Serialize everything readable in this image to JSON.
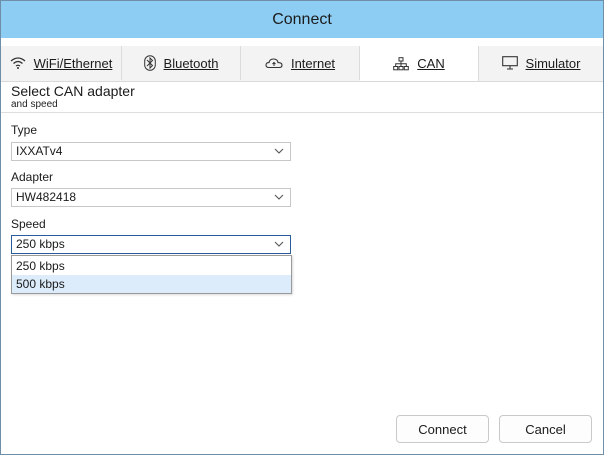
{
  "window": {
    "title": "Connect"
  },
  "tabs": [
    {
      "label": "WiFi/Ethernet",
      "icon": "wifi-icon",
      "active": false
    },
    {
      "label": "Bluetooth",
      "icon": "bluetooth-icon",
      "active": false
    },
    {
      "label": "Internet",
      "icon": "cloud-icon",
      "active": false
    },
    {
      "label": "CAN",
      "icon": "network-icon",
      "active": true
    },
    {
      "label": "Simulator",
      "icon": "monitor-icon",
      "active": false
    }
  ],
  "panel": {
    "title": "Select CAN adapter",
    "subtitle": "and speed"
  },
  "fields": {
    "type": {
      "label": "Type",
      "value": "IXXATv4"
    },
    "adapter": {
      "label": "Adapter",
      "value": "HW482418"
    },
    "speed": {
      "label": "Speed",
      "value": "250 kbps",
      "options": [
        "250 kbps",
        "500 kbps"
      ],
      "highlighted": "500 kbps"
    }
  },
  "buttons": {
    "connect": "Connect",
    "cancel": "Cancel"
  },
  "colors": {
    "titlebar": "#8ecdf3",
    "focus": "#2b5c9a",
    "highlight": "#dcecfb"
  }
}
